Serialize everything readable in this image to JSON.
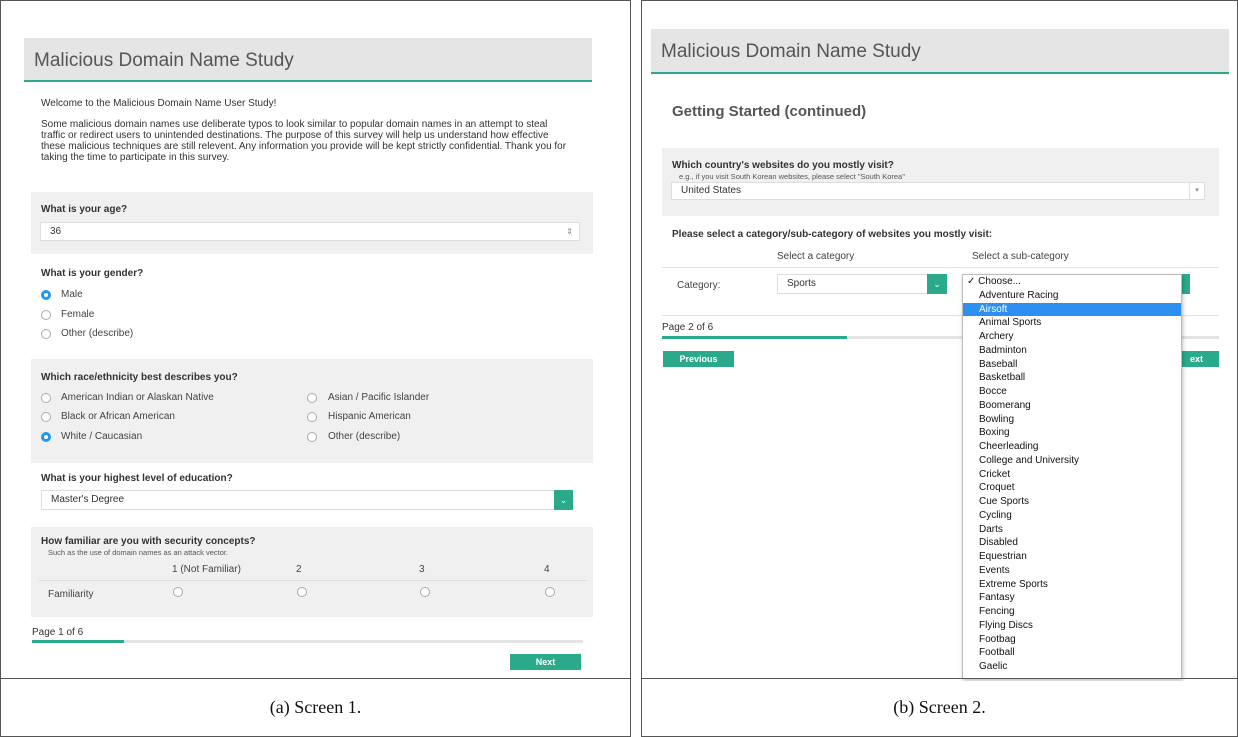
{
  "title": "Malicious Domain Name Study",
  "screen1": {
    "caption": "(a) Screen 1.",
    "welcome": "Welcome to the Malicious Domain Name User Study!",
    "intro_lines": [
      "Some malicious domain names use deliberate typos to look similar to popular domain names in an attempt to steal",
      "traffic or redirect users to unintended destinations. The purpose of this survey will help us understand how effective",
      "these malicious techniques are still relevent. Any information you provide will be kept strictly confidential. Thank you for",
      "taking the time to participate in this survey."
    ],
    "age_q": "What is your age?",
    "age_value": "36",
    "gender_q": "What is your gender?",
    "gender_options": [
      "Male",
      "Female",
      "Other (describe)"
    ],
    "race_q": "Which race/ethnicity best describes you?",
    "race_options_left": [
      "American Indian or Alaskan Native",
      "Black or African American",
      "White / Caucasian"
    ],
    "race_options_right": [
      "Asian / Pacific Islander",
      "Hispanic American",
      "Other (describe)"
    ],
    "edu_q": "What is your highest level of education?",
    "edu_value": "Master's Degree",
    "sec_q": "How familiar are you with security concepts?",
    "sec_sub": "Such as the use of domain names as an attack vector.",
    "scale": [
      "1 (Not Familiar)",
      "2",
      "3",
      "4"
    ],
    "row_label": "Familiarity",
    "page": "Page 1 of 6",
    "progress": 0.167,
    "next": "Next"
  },
  "screen2": {
    "caption": "(b) Screen 2.",
    "heading": "Getting Started (continued)",
    "country_q": "Which country's websites do you mostly visit?",
    "country_hint": "e.g., if you visit South Korean websites, please select \"South Korea\"",
    "country_value": "United States",
    "cat_q": "Please select a category/sub-category of websites you mostly visit:",
    "col_category": "Select a category",
    "col_subcategory": "Select a sub-category",
    "row_label": "Category:",
    "category_value": "Sports",
    "page": "Page 2 of 6",
    "progress": 0.333,
    "previous": "Previous",
    "next_partial": "ext",
    "dropdown_items": [
      "✓ Choose...",
      "Adventure Racing",
      "Airsoft",
      "Animal Sports",
      "Archery",
      "Badminton",
      "Baseball",
      "Basketball",
      "Bocce",
      "Boomerang",
      "Bowling",
      "Boxing",
      "Cheerleading",
      "College and University",
      "Cricket",
      "Croquet",
      "Cue Sports",
      "Cycling",
      "Darts",
      "Disabled",
      "Equestrian",
      "Events",
      "Extreme Sports",
      "Fantasy",
      "Fencing",
      "Flying Discs",
      "Footbag",
      "Football",
      "Gaelic"
    ],
    "highlighted_index": 2
  },
  "colors": {
    "accent": "#2baa8b",
    "radio_selected": "#2196f3",
    "highlight": "#2d8ff0"
  }
}
